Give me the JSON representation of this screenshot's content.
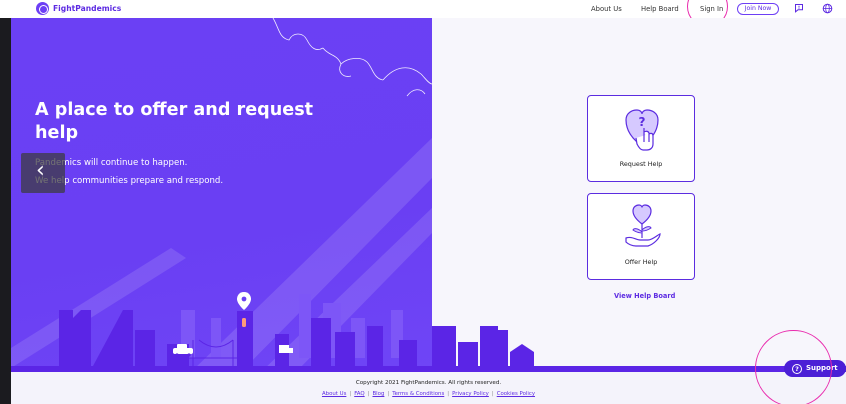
{
  "nav": {
    "brand": "FightPandemics",
    "about": "About Us",
    "help_board": "Help Board",
    "sign_in": "Sign In",
    "join_now": "Join Now"
  },
  "hero": {
    "title": "A place to offer and request help",
    "subtitle_line1": "Pandemics will continue to happen.",
    "subtitle_line2": "We help communities prepare and respond."
  },
  "carousel": {
    "prev_glyph": "‹"
  },
  "cards": {
    "request_label": "Request Help",
    "offer_label": "Offer Help"
  },
  "view_help_board": "View Help Board",
  "footer": {
    "copyright": "Copyright 2021 FightPandemics. All rights reserved.",
    "links": [
      "About Us",
      "FAQ",
      "Blog",
      "Terms & Conditions",
      "Privacy Policy",
      "Cookies Policy"
    ]
  },
  "support": {
    "label": "Support",
    "icon_glyph": "?"
  },
  "colors": {
    "brand": "#6d3ff5",
    "hero_bg": "#6a3ff3",
    "skyline": "#5b25e6",
    "annotation_ring": "#e92bae"
  },
  "icons": [
    "logo-icon",
    "chat-icon",
    "globe-icon",
    "chevron-left-icon",
    "request-help-icon",
    "offer-help-icon",
    "question-icon",
    "location-pin-icon"
  ]
}
